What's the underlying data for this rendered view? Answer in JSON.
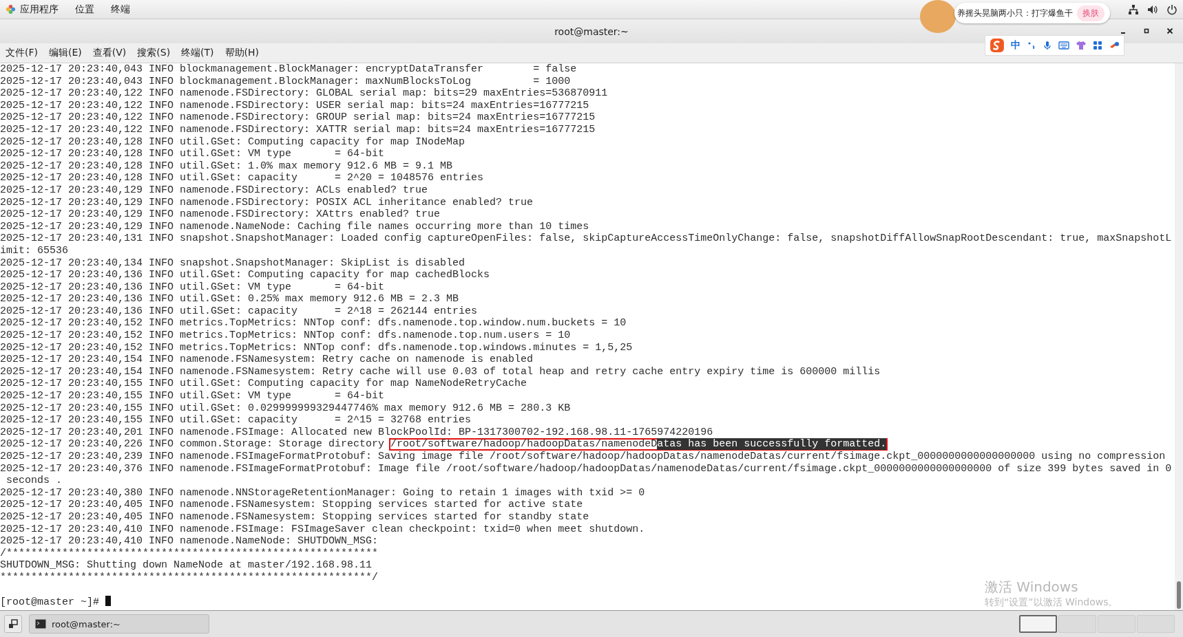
{
  "top_bar": {
    "menus": [
      "应用程序",
      "位置",
      "终端"
    ],
    "notification": {
      "text": "养摇头晃脑两小只：打字爆鱼干",
      "button": "换肤"
    }
  },
  "ime_toolbar": {
    "mode": "中"
  },
  "window": {
    "title": "root@master:~",
    "menu": [
      "文件(F)",
      "编辑(E)",
      "查看(V)",
      "搜索(S)",
      "终端(T)",
      "帮助(H)"
    ]
  },
  "terminal": {
    "lines": [
      {
        "kind": "log",
        "text": "2025-12-17 20:23:40,043 INFO blockmanagement.BlockManager: encryptDataTransfer        = false"
      },
      {
        "kind": "log",
        "text": "2025-12-17 20:23:40,043 INFO blockmanagement.BlockManager: maxNumBlocksToLog          = 1000"
      },
      {
        "kind": "log",
        "text": "2025-12-17 20:23:40,122 INFO namenode.FSDirectory: GLOBAL serial map: bits=29 maxEntries=536870911"
      },
      {
        "kind": "log",
        "text": "2025-12-17 20:23:40,122 INFO namenode.FSDirectory: USER serial map: bits=24 maxEntries=16777215"
      },
      {
        "kind": "log",
        "text": "2025-12-17 20:23:40,122 INFO namenode.FSDirectory: GROUP serial map: bits=24 maxEntries=16777215"
      },
      {
        "kind": "log",
        "text": "2025-12-17 20:23:40,122 INFO namenode.FSDirectory: XATTR serial map: bits=24 maxEntries=16777215"
      },
      {
        "kind": "log",
        "text": "2025-12-17 20:23:40,128 INFO util.GSet: Computing capacity for map INodeMap"
      },
      {
        "kind": "log",
        "text": "2025-12-17 20:23:40,128 INFO util.GSet: VM type       = 64-bit"
      },
      {
        "kind": "log",
        "text": "2025-12-17 20:23:40,128 INFO util.GSet: 1.0% max memory 912.6 MB = 9.1 MB"
      },
      {
        "kind": "log",
        "text": "2025-12-17 20:23:40,128 INFO util.GSet: capacity      = 2^20 = 1048576 entries"
      },
      {
        "kind": "log",
        "text": "2025-12-17 20:23:40,129 INFO namenode.FSDirectory: ACLs enabled? true"
      },
      {
        "kind": "log",
        "text": "2025-12-17 20:23:40,129 INFO namenode.FSDirectory: POSIX ACL inheritance enabled? true"
      },
      {
        "kind": "log",
        "text": "2025-12-17 20:23:40,129 INFO namenode.FSDirectory: XAttrs enabled? true"
      },
      {
        "kind": "log",
        "text": "2025-12-17 20:23:40,129 INFO namenode.NameNode: Caching file names occurring more than 10 times"
      },
      {
        "kind": "log",
        "text": "2025-12-17 20:23:40,131 INFO snapshot.SnapshotManager: Loaded config captureOpenFiles: false, skipCaptureAccessTimeOnlyChange: false, snapshotDiffAllowSnapRootDescendant: true, maxSnapshotL"
      },
      {
        "kind": "log",
        "text": "imit: 65536"
      },
      {
        "kind": "log",
        "text": "2025-12-17 20:23:40,134 INFO snapshot.SnapshotManager: SkipList is disabled"
      },
      {
        "kind": "log",
        "text": "2025-12-17 20:23:40,136 INFO util.GSet: Computing capacity for map cachedBlocks"
      },
      {
        "kind": "log",
        "text": "2025-12-17 20:23:40,136 INFO util.GSet: VM type       = 64-bit"
      },
      {
        "kind": "log",
        "text": "2025-12-17 20:23:40,136 INFO util.GSet: 0.25% max memory 912.6 MB = 2.3 MB"
      },
      {
        "kind": "log",
        "text": "2025-12-17 20:23:40,136 INFO util.GSet: capacity      = 2^18 = 262144 entries"
      },
      {
        "kind": "log",
        "text": "2025-12-17 20:23:40,152 INFO metrics.TopMetrics: NNTop conf: dfs.namenode.top.window.num.buckets = 10"
      },
      {
        "kind": "log",
        "text": "2025-12-17 20:23:40,152 INFO metrics.TopMetrics: NNTop conf: dfs.namenode.top.num.users = 10"
      },
      {
        "kind": "log",
        "text": "2025-12-17 20:23:40,152 INFO metrics.TopMetrics: NNTop conf: dfs.namenode.top.windows.minutes = 1,5,25"
      },
      {
        "kind": "log",
        "text": "2025-12-17 20:23:40,154 INFO namenode.FSNamesystem: Retry cache on namenode is enabled"
      },
      {
        "kind": "log",
        "text": "2025-12-17 20:23:40,154 INFO namenode.FSNamesystem: Retry cache will use 0.03 of total heap and retry cache entry expiry time is 600000 millis"
      },
      {
        "kind": "log",
        "text": "2025-12-17 20:23:40,155 INFO util.GSet: Computing capacity for map NameNodeRetryCache"
      },
      {
        "kind": "log",
        "text": "2025-12-17 20:23:40,155 INFO util.GSet: VM type       = 64-bit"
      },
      {
        "kind": "log",
        "text": "2025-12-17 20:23:40,155 INFO util.GSet: 0.029999999329447746% max memory 912.6 MB = 280.3 KB"
      },
      {
        "kind": "log",
        "text": "2025-12-17 20:23:40,155 INFO util.GSet: capacity      = 2^15 = 32768 entries"
      },
      {
        "kind": "log",
        "text": "2025-12-17 20:23:40,201 INFO namenode.FSImage: Allocated new BlockPoolId: BP-1317300702-192.168.98.11-1765974220196"
      },
      {
        "kind": "marked",
        "text": "2025-12-17 20:23:40,226 INFO common.Storage: Storage directory ",
        "boxed": "/root/software/hadoop/hadoopDatas/namenodeD",
        "selected": "atas has been successfully formatted."
      },
      {
        "kind": "log",
        "text": "2025-12-17 20:23:40,239 INFO namenode.FSImageFormatProtobuf: Saving image file /root/software/hadoop/hadoopDatas/namenodeDatas/current/fsimage.ckpt_0000000000000000000 using no compression"
      },
      {
        "kind": "log",
        "text": "2025-12-17 20:23:40,376 INFO namenode.FSImageFormatProtobuf: Image file /root/software/hadoop/hadoopDatas/namenodeDatas/current/fsimage.ckpt_0000000000000000000 of size 399 bytes saved in 0"
      },
      {
        "kind": "log",
        "text": " seconds ."
      },
      {
        "kind": "log",
        "text": "2025-12-17 20:23:40,380 INFO namenode.NNStorageRetentionManager: Going to retain 1 images with txid >= 0"
      },
      {
        "kind": "log",
        "text": "2025-12-17 20:23:40,405 INFO namenode.FSNamesystem: Stopping services started for active state"
      },
      {
        "kind": "log",
        "text": "2025-12-17 20:23:40,405 INFO namenode.FSNamesystem: Stopping services started for standby state"
      },
      {
        "kind": "log",
        "text": "2025-12-17 20:23:40,410 INFO namenode.FSImage: FSImageSaver clean checkpoint: txid=0 when meet shutdown."
      },
      {
        "kind": "log",
        "text": "2025-12-17 20:23:40,410 INFO namenode.NameNode: SHUTDOWN_MSG:"
      },
      {
        "kind": "log",
        "text": "/************************************************************"
      },
      {
        "kind": "log",
        "text": "SHUTDOWN_MSG: Shutting down NameNode at master/192.168.98.11"
      },
      {
        "kind": "log",
        "text": "************************************************************/"
      }
    ],
    "prompt": "[root@master ~]# "
  },
  "taskbar": {
    "tasks": [
      "root@master:~"
    ],
    "workspaces": [
      {
        "selected": true
      },
      {
        "selected": false
      },
      {
        "selected": false
      },
      {
        "selected": false
      }
    ]
  },
  "activation_notice": {
    "title": "激活 Windows",
    "text": "转到“设置”以激活 Windows。"
  }
}
